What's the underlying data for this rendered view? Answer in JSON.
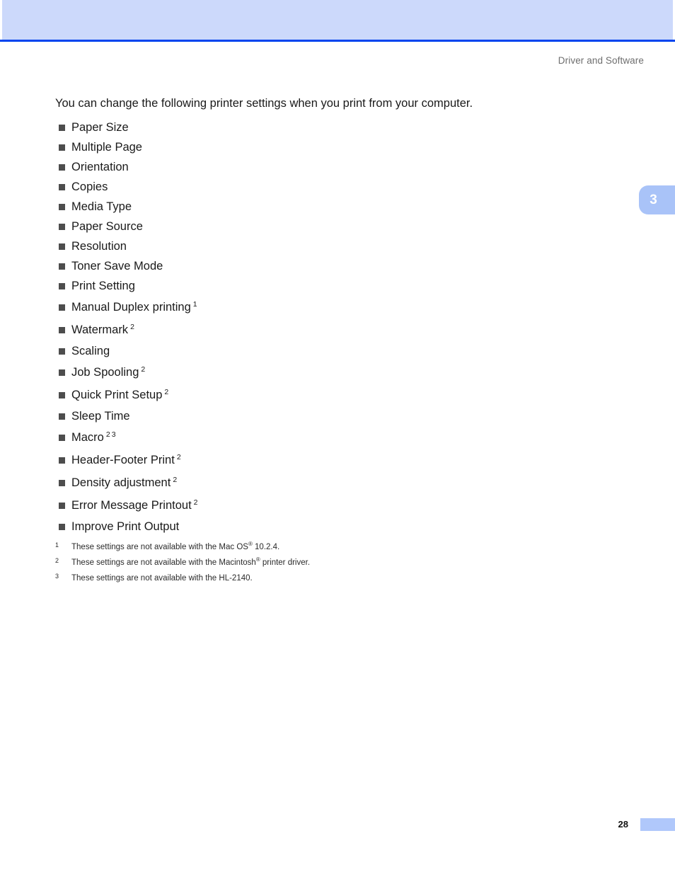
{
  "header": {
    "running_head": "Driver and Software",
    "banner_color": "#ccd9fb",
    "rule_color": "#0044ee"
  },
  "chapter_tab": {
    "number": "3",
    "color": "#a9c3f8",
    "text_color": "#ffffff"
  },
  "main": {
    "intro_paragraph": "You can change the following printer settings when you print from your computer.",
    "settings": [
      {
        "label": "Paper Size",
        "notes": []
      },
      {
        "label": "Multiple Page",
        "notes": []
      },
      {
        "label": "Orientation",
        "notes": []
      },
      {
        "label": "Copies",
        "notes": []
      },
      {
        "label": "Media Type",
        "notes": []
      },
      {
        "label": "Paper Source",
        "notes": []
      },
      {
        "label": "Resolution",
        "notes": []
      },
      {
        "label": "Toner Save Mode",
        "notes": []
      },
      {
        "label": "Print Setting",
        "notes": []
      },
      {
        "label": "Manual Duplex printing",
        "notes": [
          "1"
        ]
      },
      {
        "label": "Watermark",
        "notes": [
          "2"
        ]
      },
      {
        "label": "Scaling",
        "notes": []
      },
      {
        "label": "Job Spooling",
        "notes": [
          "2"
        ]
      },
      {
        "label": "Quick Print Setup",
        "notes": [
          "2"
        ]
      },
      {
        "label": "Sleep Time",
        "notes": []
      },
      {
        "label": "Macro",
        "notes": [
          "2",
          "3"
        ]
      },
      {
        "label": "Header-Footer Print",
        "notes": [
          "2"
        ]
      },
      {
        "label": "Density adjustment",
        "notes": [
          "2"
        ]
      },
      {
        "label": "Error Message Printout",
        "notes": [
          "2"
        ]
      },
      {
        "label": "Improve Print Output",
        "notes": []
      }
    ]
  },
  "footnotes": [
    {
      "marker": "1",
      "before": "These settings are not available with the Mac OS",
      "reg": "®",
      "after": " 10.2.4."
    },
    {
      "marker": "2",
      "before": "These settings are not available with the Macintosh",
      "reg": "®",
      "after": " printer driver."
    },
    {
      "marker": "3",
      "before": "These settings are not available with the HL-2140.",
      "reg": "",
      "after": ""
    }
  ],
  "footer": {
    "page_number": "28",
    "bar_color": "#b0c8fb"
  }
}
